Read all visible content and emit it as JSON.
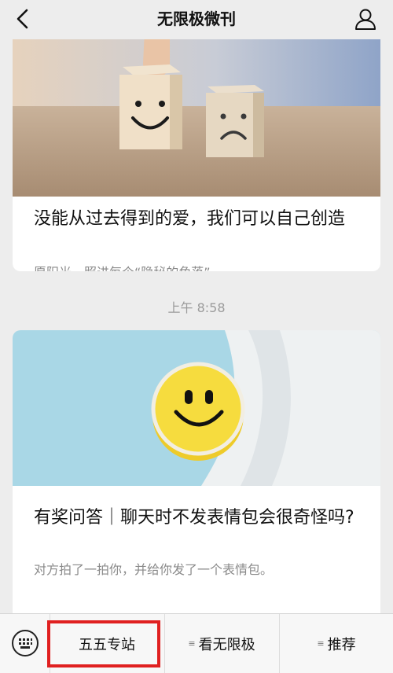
{
  "header": {
    "title": "无限极微刊",
    "back_icon": "chevron-left-icon",
    "profile_icon": "person-icon"
  },
  "articles": [
    {
      "title": "没能从过去得到的爱，我们可以自己创造",
      "subtitle": "愿阳光，照进每个“隐秘的角落”。",
      "image": "smiley-and-sad-wooden-cubes"
    },
    {
      "title": "有奖问答｜聊天时不发表情包会很奇怪吗?",
      "subtitle": "对方拍了一拍你，并给你发了一个表情包。",
      "image": "yellow-smiley-badge"
    }
  ],
  "timestamp": "上午 8:58",
  "menu": {
    "keyboard_icon": "keyboard-icon",
    "items": [
      {
        "label": "五五专站",
        "has_submenu": false
      },
      {
        "label": "看无限极",
        "has_submenu": true
      },
      {
        "label": "推荐",
        "has_submenu": true
      }
    ],
    "highlight_color": "#e02020"
  }
}
